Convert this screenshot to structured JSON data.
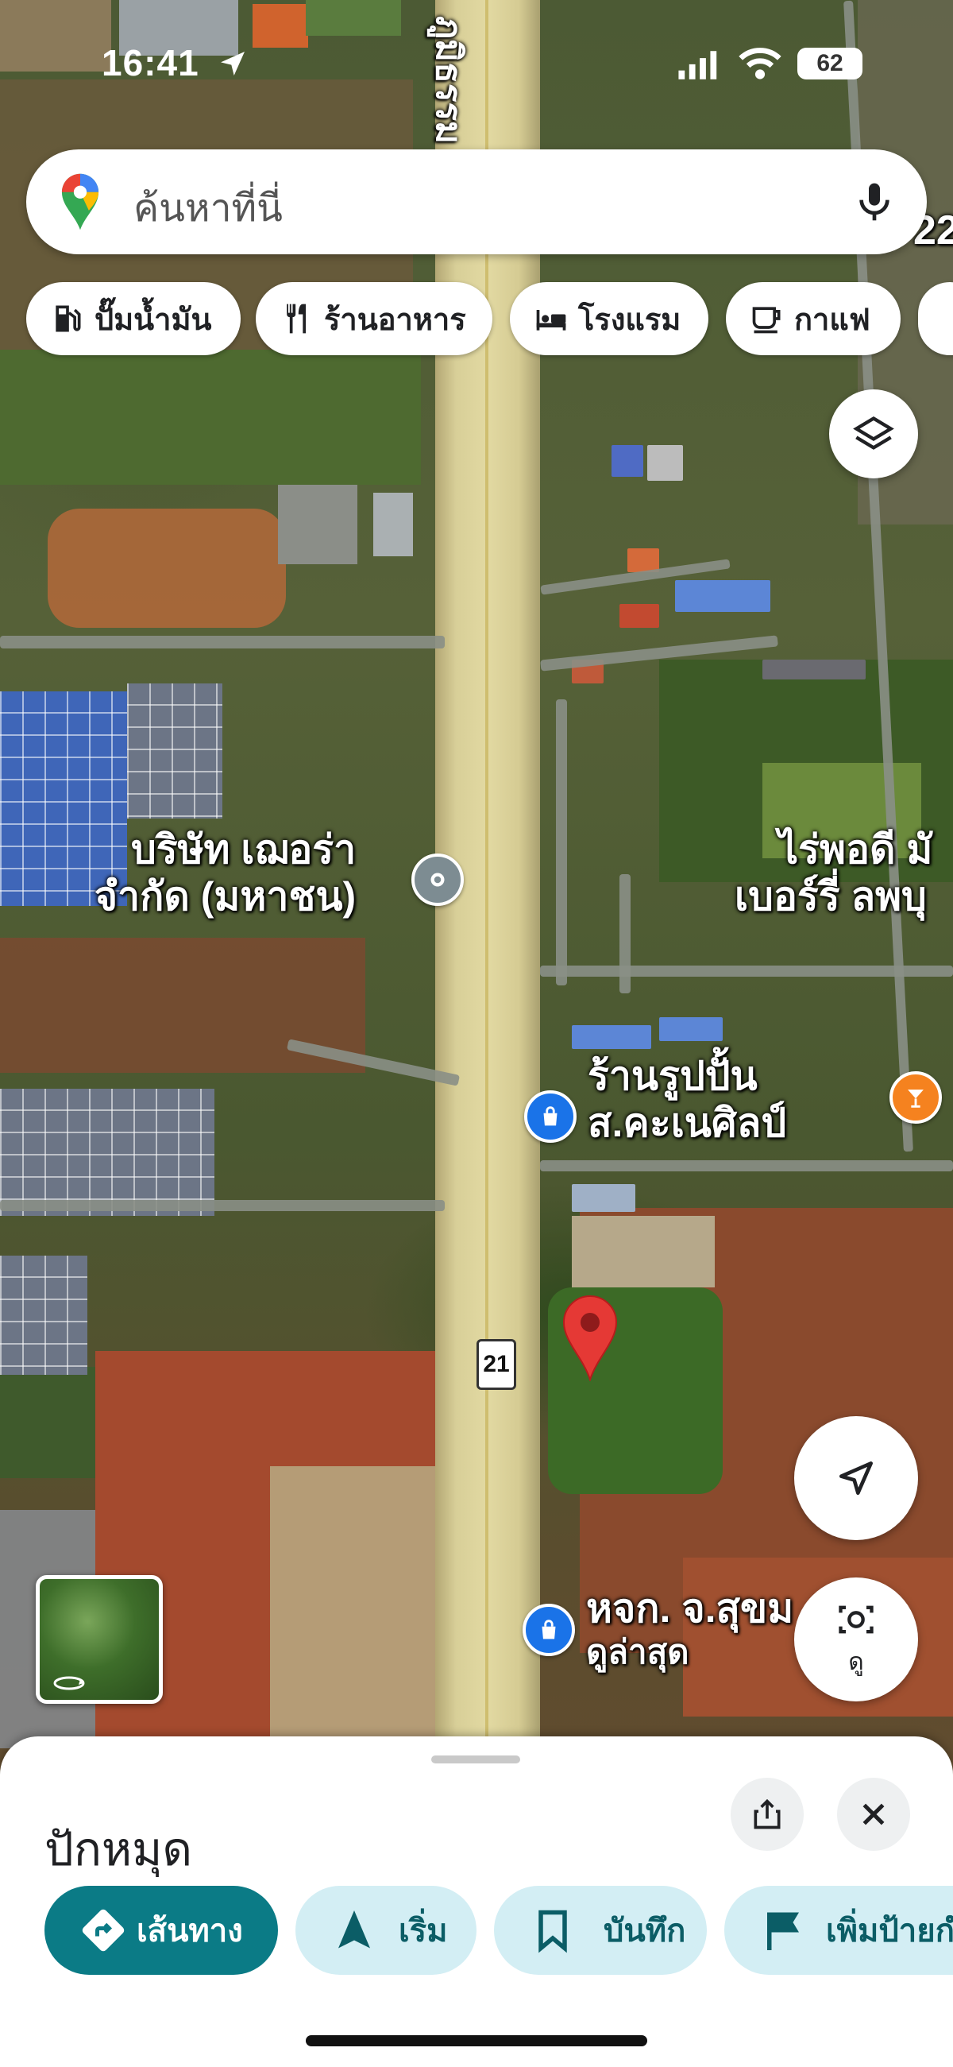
{
  "status_bar": {
    "time": "16:41",
    "battery": "62"
  },
  "search": {
    "placeholder": "ค้นหาที่นี่"
  },
  "chips": [
    {
      "label": "ปั๊มน้ำมัน",
      "icon": "gas-station-icon"
    },
    {
      "label": "ร้านอาหาร",
      "icon": "restaurant-icon"
    },
    {
      "label": "โรงแรม",
      "icon": "hotel-icon"
    },
    {
      "label": "กาแฟ",
      "icon": "coffee-icon"
    }
  ],
  "map": {
    "labels": {
      "company_line1": "บริษัท เฌอร่า",
      "company_line2": "จำกัด (มหาชน)",
      "farm_line1": "ไร่พอดี มั",
      "farm_line2": "เบอร์รี่ ลพบุ",
      "shop_line1": "ร้านรูปปั้น",
      "shop_line2": "ส.คะเนศิลป์",
      "partnership_line1": "หจก. จ.สุขม",
      "partnership_line2": "ดูล่าสุด",
      "road_name_top": "ภูมิธรรม",
      "route_number": "21",
      "top_right_partial": "22"
    }
  },
  "view_button_label": "ดู",
  "sheet": {
    "title": "ปักหมุด",
    "actions": [
      {
        "label": "เส้นทาง",
        "icon": "directions-icon",
        "primary": true
      },
      {
        "label": "เริ่ม",
        "icon": "navigation-arrow-icon",
        "primary": false
      },
      {
        "label": "บันทึก",
        "icon": "bookmark-icon",
        "primary": false
      },
      {
        "label": "เพิ่มป้ายกำ",
        "icon": "flag-icon",
        "primary": false
      }
    ]
  },
  "colors": {
    "accent": "#0b7b86",
    "action_bg": "#d3eef4",
    "pin": "#e53935",
    "poi_blue": "#1a73e8",
    "poi_orange": "#f5821f"
  }
}
